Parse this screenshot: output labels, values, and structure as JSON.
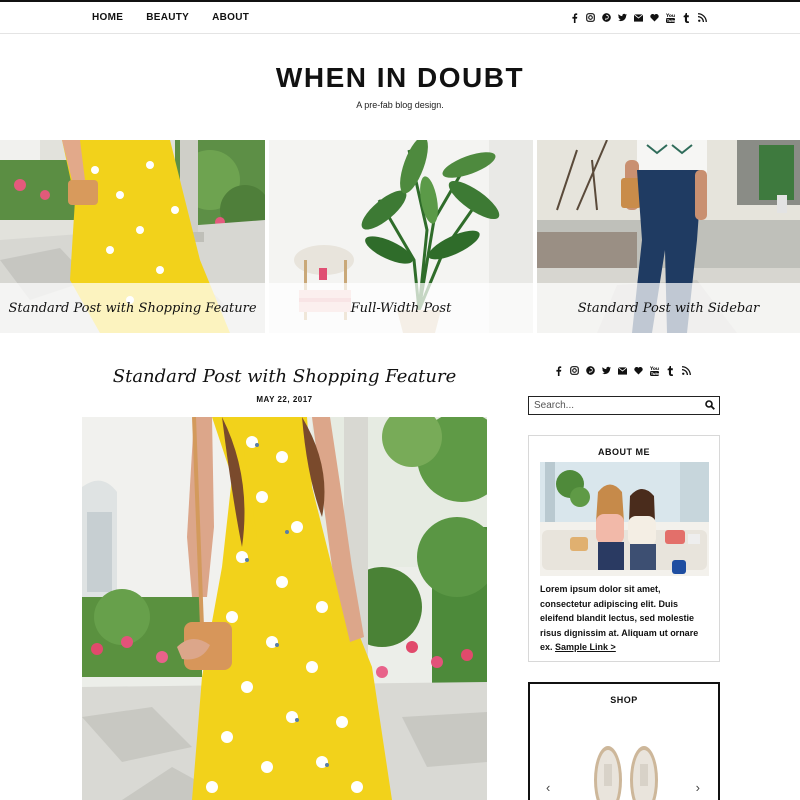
{
  "nav": {
    "items": [
      "HOME",
      "BEAUTY",
      "ABOUT"
    ]
  },
  "social_icons": [
    "facebook-icon",
    "instagram-icon",
    "pinterest-icon",
    "twitter-icon",
    "email-icon",
    "heart-icon",
    "youtube-icon",
    "tumblr-icon",
    "rss-icon"
  ],
  "header": {
    "title": "WHEN IN DOUBT",
    "tagline": "A pre-fab blog design."
  },
  "featured": [
    {
      "label": "Standard Post with Shopping Feature"
    },
    {
      "label": "Full-Width Post"
    },
    {
      "label": "Standard Post with Sidebar"
    }
  ],
  "post": {
    "title": "Standard Post with Shopping Feature",
    "date": "MAY 22, 2017"
  },
  "sidebar": {
    "search_placeholder": "Search...",
    "about": {
      "heading": "ABOUT ME",
      "text": "Lorem ipsum dolor sit amet, consectetur adipiscing elit. Duis eleifend blandit lectus, sed molestie risus dignissim at. Aliquam ut ornare ex.",
      "link": "Sample Link >"
    },
    "shop": {
      "heading": "SHOP",
      "prev": "‹",
      "next": "›"
    }
  },
  "colors": {
    "text": "#111111",
    "dress_yellow": "#f2d21b",
    "foliage": "#4f8a3a"
  }
}
